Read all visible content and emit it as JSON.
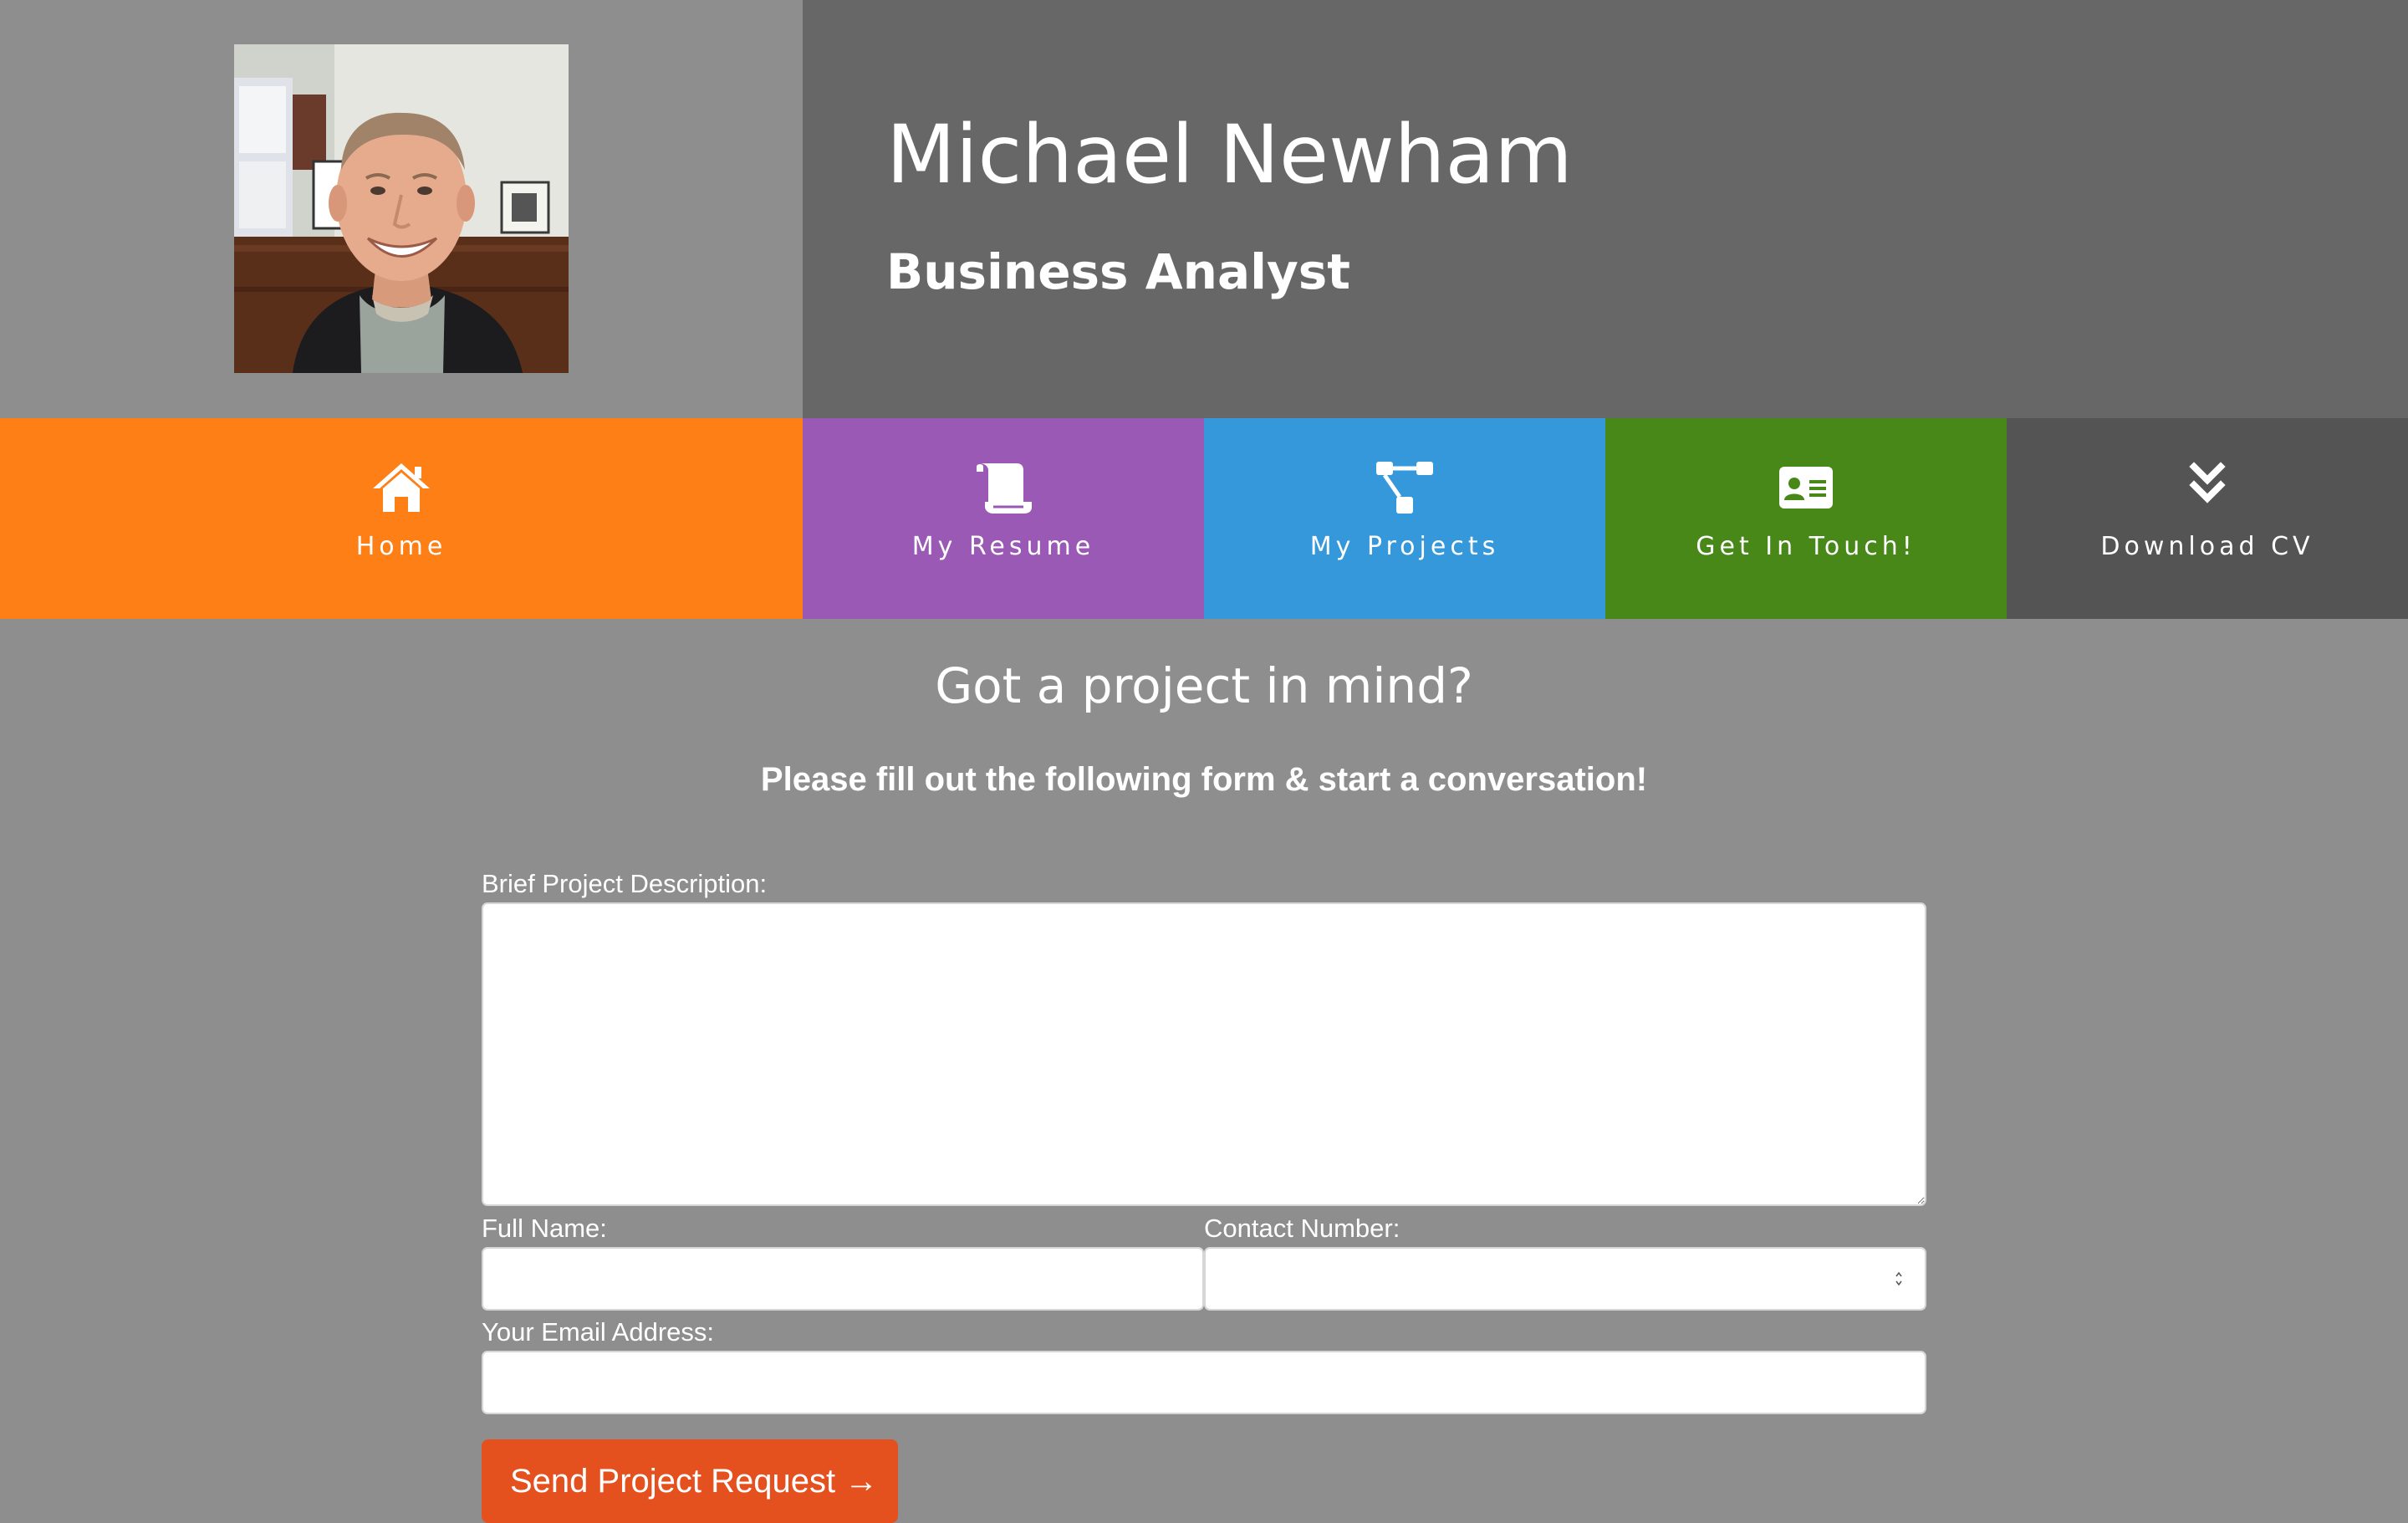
{
  "header": {
    "name": "Michael Newham",
    "role": "Business Analyst",
    "avatar_alt": "profile-photo"
  },
  "nav": {
    "items": [
      {
        "label": "Home",
        "icon": "home-icon",
        "color": "#fd7f16"
      },
      {
        "label": "My Resume",
        "icon": "scroll-icon",
        "color": "#9b59b6"
      },
      {
        "label": "My Projects",
        "icon": "sitemap-icon",
        "color": "#3498db"
      },
      {
        "label": "Get In Touch!",
        "icon": "contact-card-icon",
        "color": "#478818"
      },
      {
        "label": "Download CV",
        "icon": "double-chevron-down-icon",
        "color": "#545454"
      }
    ]
  },
  "content": {
    "headline": "Got a project in mind?",
    "subline": "Please fill out the following form & start a conversation!"
  },
  "form": {
    "description": {
      "label": "Brief Project Description:",
      "value": "",
      "placeholder": ""
    },
    "full_name": {
      "label": "Full Name:",
      "value": "",
      "placeholder": ""
    },
    "contact_number": {
      "label": "Contact Number:",
      "value": "",
      "placeholder": ""
    },
    "email": {
      "label": "Your Email Address:",
      "value": "",
      "placeholder": ""
    },
    "submit_label": "Send Project Request →"
  },
  "colors": {
    "page_bg": "#8e8e8e",
    "header_right_bg": "#676767",
    "submit_bg": "#e5501f"
  }
}
